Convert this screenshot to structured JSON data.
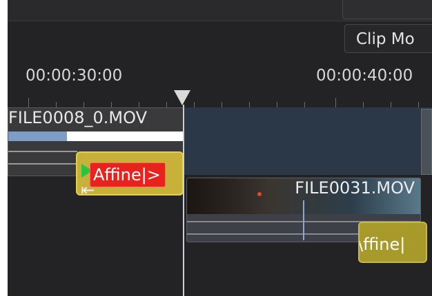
{
  "toolbar": {
    "clip_monitor_tab": "Clip Mo"
  },
  "ruler": {
    "timecode_1": "00:00:30:00",
    "timecode_2": "00:00:40:00"
  },
  "clips": {
    "clip_1_title": "FILE0008_0.MOV",
    "clip_2_title": "FILE0031.MOV"
  },
  "effects": {
    "affine_1_label": "Affine|>",
    "affine_2_label": "\\ffine|"
  },
  "icons": {
    "playhead": "playhead-icon",
    "resize_cursor": "resize-cursor-icon",
    "play_triangle": "play-icon"
  }
}
